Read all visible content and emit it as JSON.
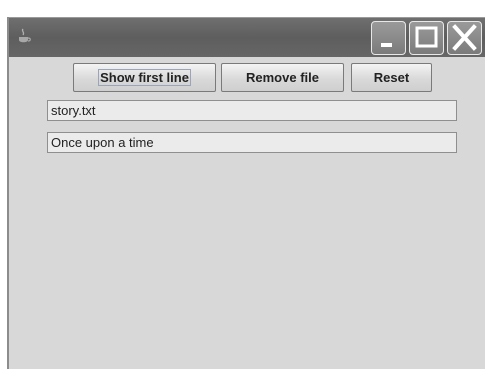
{
  "window": {
    "controls": {
      "minimize_icon": "minimize-icon",
      "maximize_icon": "maximize-icon",
      "close_icon": "close-icon"
    }
  },
  "toolbar": {
    "show_first_line_label": "Show first line",
    "remove_file_label": "Remove file",
    "reset_label": "Reset"
  },
  "fields": {
    "filename_value": "story.txt",
    "first_line_value": "Once upon a time"
  }
}
